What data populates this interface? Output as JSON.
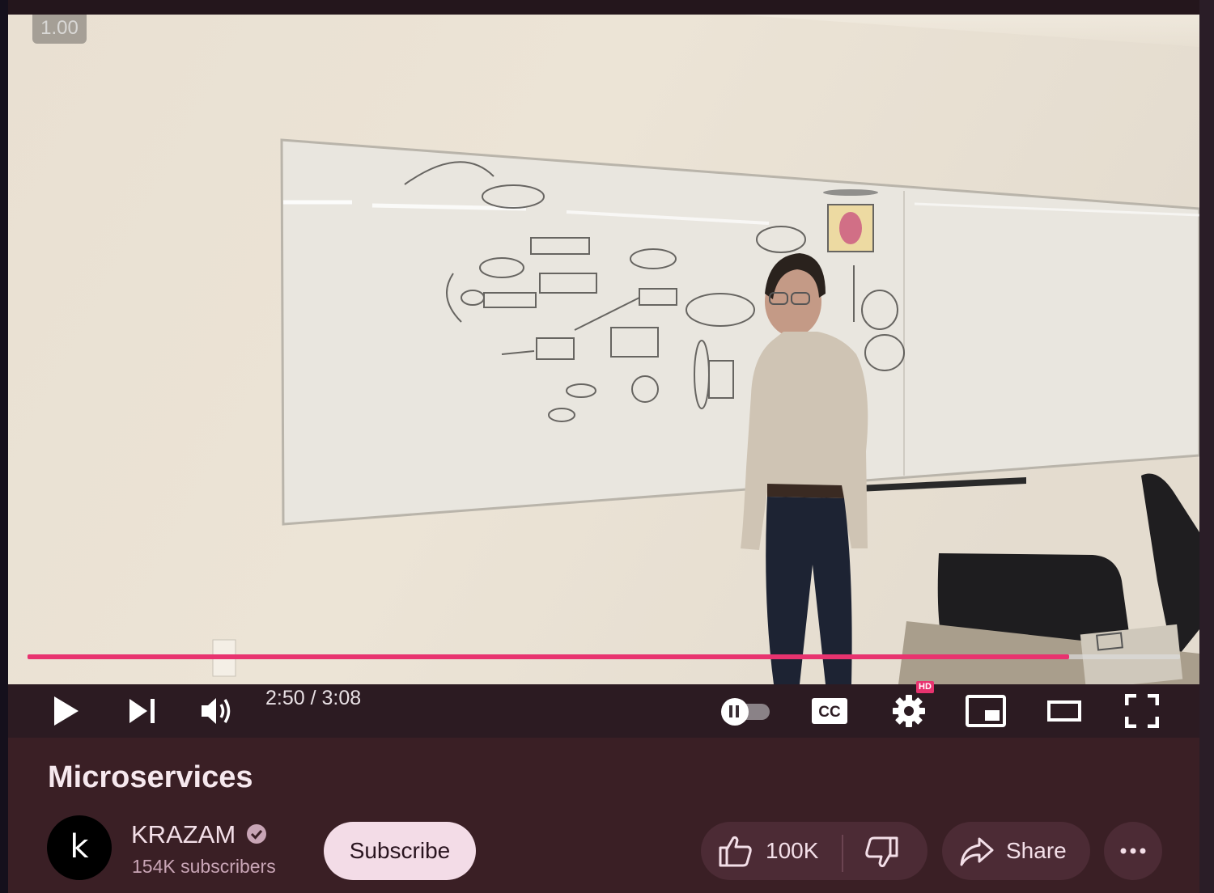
{
  "player": {
    "speed_badge": "1.00",
    "progress_fraction": 0.904,
    "time_display": "2:50 / 3:08",
    "hd_badge": "HD",
    "controls": {
      "play_icon": "play-icon",
      "next_icon": "skip-next-icon",
      "volume_icon": "volume-icon",
      "autoplay_icon": "autoplay-toggle",
      "captions_icon": "cc-icon",
      "settings_icon": "gear-icon",
      "miniplayer_icon": "miniplayer-icon",
      "theater_icon": "theater-icon",
      "fullscreen_icon": "fullscreen-icon"
    },
    "captions_label": "CC"
  },
  "video": {
    "title": "Microservices"
  },
  "channel": {
    "avatar_letter": "k",
    "name": "KRAZAM",
    "subscribers": "154K subscribers",
    "subscribe_label": "Subscribe"
  },
  "actions": {
    "like_count": "100K",
    "share_label": "Share"
  },
  "colors": {
    "progress": "#e8336f",
    "info_bg": "#3a1f25",
    "subscribe_bg": "#f3dce7",
    "pill_bg": "#4c2b35"
  }
}
